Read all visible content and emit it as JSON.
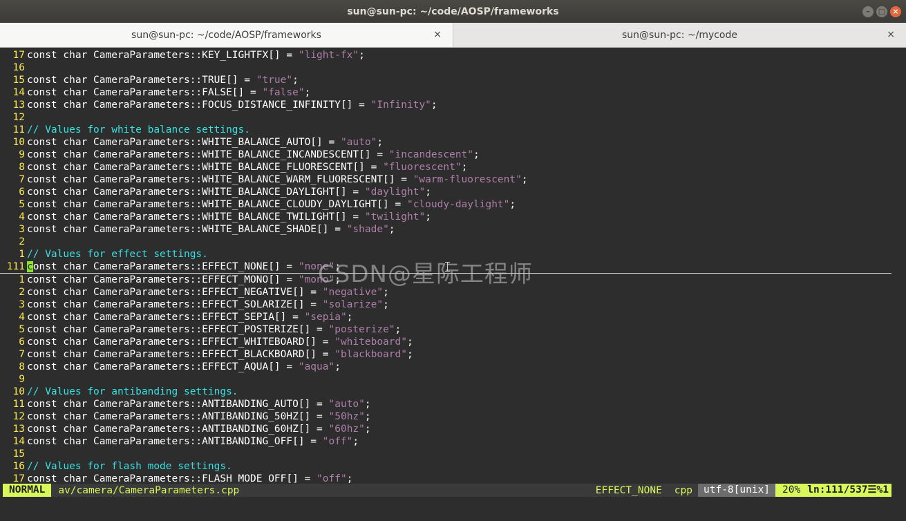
{
  "window": {
    "title": "sun@sun-pc: ~/code/AOSP/frameworks",
    "controls": {
      "minimize": "–",
      "maximize": "□",
      "close": "×"
    }
  },
  "tabs": [
    {
      "label": "sun@sun-pc: ~/code/AOSP/frameworks",
      "close": "×"
    },
    {
      "label": "sun@sun-pc: ~/mycode",
      "close": "×"
    }
  ],
  "editor": {
    "lines": [
      {
        "num": "17",
        "kind": "code",
        "pre": "const char CameraParameters::KEY_LIGHTFX[] = ",
        "str": "\"light-fx\"",
        "post": ";"
      },
      {
        "num": "16",
        "kind": "blank"
      },
      {
        "num": "15",
        "kind": "code",
        "pre": "const char CameraParameters::TRUE[] = ",
        "str": "\"true\"",
        "post": ";"
      },
      {
        "num": "14",
        "kind": "code",
        "pre": "const char CameraParameters::FALSE[] = ",
        "str": "\"false\"",
        "post": ";"
      },
      {
        "num": "13",
        "kind": "code",
        "pre": "const char CameraParameters::FOCUS_DISTANCE_INFINITY[] = ",
        "str": "\"Infinity\"",
        "post": ";"
      },
      {
        "num": "12",
        "kind": "blank"
      },
      {
        "num": "11",
        "kind": "comment",
        "text": "// Values for white balance settings."
      },
      {
        "num": "10",
        "kind": "code",
        "pre": "const char CameraParameters::WHITE_BALANCE_AUTO[] = ",
        "str": "\"auto\"",
        "post": ";"
      },
      {
        "num": "9",
        "kind": "code",
        "pre": "const char CameraParameters::WHITE_BALANCE_INCANDESCENT[] = ",
        "str": "\"incandescent\"",
        "post": ";"
      },
      {
        "num": "8",
        "kind": "code",
        "pre": "const char CameraParameters::WHITE_BALANCE_FLUORESCENT[] = ",
        "str": "\"fluorescent\"",
        "post": ";"
      },
      {
        "num": "7",
        "kind": "code",
        "pre": "const char CameraParameters::WHITE_BALANCE_WARM_FLUORESCENT[] = ",
        "str": "\"warm-fluorescent\"",
        "post": ";"
      },
      {
        "num": "6",
        "kind": "code",
        "pre": "const char CameraParameters::WHITE_BALANCE_DAYLIGHT[] = ",
        "str": "\"daylight\"",
        "post": ";"
      },
      {
        "num": "5",
        "kind": "code",
        "pre": "const char CameraParameters::WHITE_BALANCE_CLOUDY_DAYLIGHT[] = ",
        "str": "\"cloudy-daylight\"",
        "post": ";"
      },
      {
        "num": "4",
        "kind": "code",
        "pre": "const char CameraParameters::WHITE_BALANCE_TWILIGHT[] = ",
        "str": "\"twilight\"",
        "post": ";"
      },
      {
        "num": "3",
        "kind": "code",
        "pre": "const char CameraParameters::WHITE_BALANCE_SHADE[] = ",
        "str": "\"shade\"",
        "post": ";"
      },
      {
        "num": "2",
        "kind": "blank"
      },
      {
        "num": "1",
        "kind": "comment",
        "text": "// Values for effect settings."
      },
      {
        "num": "111",
        "kind": "code",
        "current": true,
        "cursor": "c",
        "pre": "onst char CameraParameters::EFFECT_NONE[] = ",
        "str": "\"none\"",
        "post": ";"
      },
      {
        "num": "1",
        "kind": "code",
        "pre": "const char CameraParameters::EFFECT_MONO[] = ",
        "str": "\"mono\"",
        "post": ";"
      },
      {
        "num": "2",
        "kind": "code",
        "pre": "const char CameraParameters::EFFECT_NEGATIVE[] = ",
        "str": "\"negative\"",
        "post": ";"
      },
      {
        "num": "3",
        "kind": "code",
        "pre": "const char CameraParameters::EFFECT_SOLARIZE[] = ",
        "str": "\"solarize\"",
        "post": ";"
      },
      {
        "num": "4",
        "kind": "code",
        "pre": "const char CameraParameters::EFFECT_SEPIA[] = ",
        "str": "\"sepia\"",
        "post": ";"
      },
      {
        "num": "5",
        "kind": "code",
        "pre": "const char CameraParameters::EFFECT_POSTERIZE[] = ",
        "str": "\"posterize\"",
        "post": ";"
      },
      {
        "num": "6",
        "kind": "code",
        "pre": "const char CameraParameters::EFFECT_WHITEBOARD[] = ",
        "str": "\"whiteboard\"",
        "post": ";"
      },
      {
        "num": "7",
        "kind": "code",
        "pre": "const char CameraParameters::EFFECT_BLACKBOARD[] = ",
        "str": "\"blackboard\"",
        "post": ";"
      },
      {
        "num": "8",
        "kind": "code",
        "pre": "const char CameraParameters::EFFECT_AQUA[] = ",
        "str": "\"aqua\"",
        "post": ";"
      },
      {
        "num": "9",
        "kind": "blank"
      },
      {
        "num": "10",
        "kind": "comment",
        "text": "// Values for antibanding settings."
      },
      {
        "num": "11",
        "kind": "code",
        "pre": "const char CameraParameters::ANTIBANDING_AUTO[] = ",
        "str": "\"auto\"",
        "post": ";"
      },
      {
        "num": "12",
        "kind": "code",
        "pre": "const char CameraParameters::ANTIBANDING_50HZ[] = ",
        "str": "\"50hz\"",
        "post": ";"
      },
      {
        "num": "13",
        "kind": "code",
        "pre": "const char CameraParameters::ANTIBANDING_60HZ[] = ",
        "str": "\"60hz\"",
        "post": ";"
      },
      {
        "num": "14",
        "kind": "code",
        "pre": "const char CameraParameters::ANTIBANDING_OFF[] = ",
        "str": "\"off\"",
        "post": ";"
      },
      {
        "num": "15",
        "kind": "blank"
      },
      {
        "num": "16",
        "kind": "comment",
        "text": "// Values for flash mode settings."
      },
      {
        "num": "17",
        "kind": "code",
        "pre": "const char CameraParameters::FLASH_MODE_OFF[] = ",
        "str": "\"off\"",
        "post": ";"
      }
    ]
  },
  "statusline": {
    "mode": "NORMAL",
    "file": "av/camera/CameraParameters.cpp",
    "function": "EFFECT_NONE",
    "filetype": "cpp",
    "encoding": "utf-8[unix]",
    "percent": "20%",
    "position": "ln:111/537☰%1"
  },
  "watermark": "CSDN@星际工程师",
  "colors": {
    "background": "#2d2d2d",
    "line_number": "#fce94f",
    "string": "#ad7fa8",
    "comment": "#34e2e2",
    "statusline_accent": "#d7f75a"
  }
}
